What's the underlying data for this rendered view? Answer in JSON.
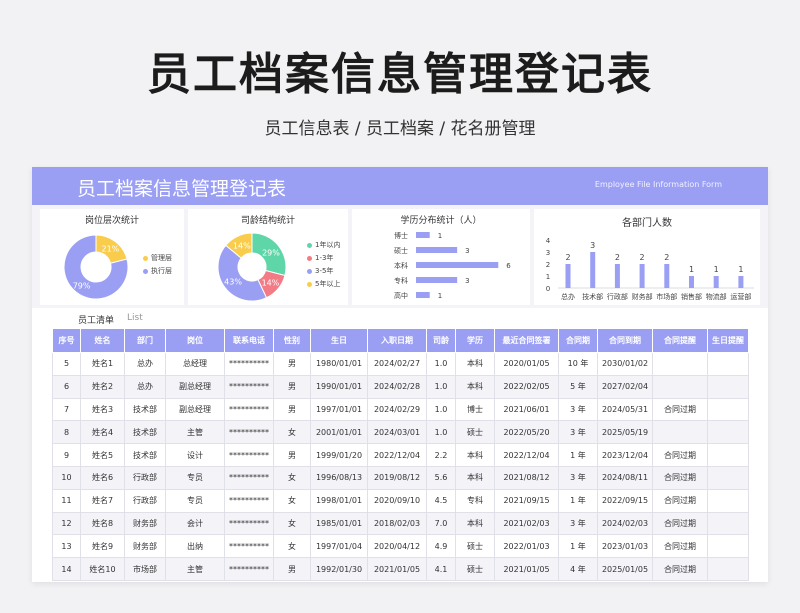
{
  "page_title": "员工档案信息管理登记表",
  "page_subtitle": "员工信息表 / 员工档案 / 花名册管理",
  "sheet": {
    "title": "员工档案信息管理登记表",
    "title_en": "Employee File Information Form"
  },
  "colors": {
    "accent": "#9a9ff4",
    "yellow": "#f9cd4b",
    "green": "#5fd6a8",
    "red": "#f37b85",
    "purple": "#9a9ff4"
  },
  "chart_data": [
    {
      "type": "pie",
      "title": "岗位层次统计",
      "categories": [
        "管理层",
        "执行层"
      ],
      "values": [
        21,
        79
      ],
      "data_labels": [
        "21%",
        "79%"
      ]
    },
    {
      "type": "pie",
      "title": "司龄结构统计",
      "categories": [
        "1年以内",
        "1-3年",
        "3-5年",
        "5年以上"
      ],
      "values": [
        29,
        14,
        43,
        14
      ],
      "data_labels": [
        "29%",
        "14%",
        "43%",
        "14%"
      ]
    },
    {
      "type": "bar",
      "orientation": "horizontal",
      "title": "学历分布统计（人）",
      "categories": [
        "博士",
        "硕士",
        "本科",
        "专科",
        "高中"
      ],
      "values": [
        1,
        3,
        6,
        3,
        1
      ],
      "xlim": [
        0,
        7
      ]
    },
    {
      "type": "bar",
      "title": "各部门人数",
      "categories": [
        "总办",
        "技术部",
        "行政部",
        "财务部",
        "市场部",
        "销售部",
        "物流部",
        "运营部"
      ],
      "values": [
        2,
        3,
        2,
        2,
        2,
        1,
        1,
        1
      ],
      "y_ticks": [
        "4",
        "3",
        "2",
        "1",
        "0"
      ],
      "ylim": [
        0,
        4
      ]
    }
  ],
  "list": {
    "title": "员工清单",
    "title_en": "List"
  },
  "table": {
    "headers": [
      "序号",
      "姓名",
      "部门",
      "岗位",
      "联系电话",
      "性别",
      "生日",
      "入职日期",
      "司龄",
      "学历",
      "最近合同签署",
      "合同期",
      "合同到期",
      "合同提醒",
      "生日提醒"
    ],
    "rows": [
      [
        "5",
        "姓名1",
        "总办",
        "总经理",
        "**********",
        "男",
        "1980/01/01",
        "2024/02/27",
        "1.0",
        "本科",
        "2020/01/05",
        "10 年",
        "2030/01/02",
        "",
        ""
      ],
      [
        "6",
        "姓名2",
        "总办",
        "副总经理",
        "**********",
        "男",
        "1990/01/01",
        "2024/02/28",
        "1.0",
        "本科",
        "2022/02/05",
        "5 年",
        "2027/02/04",
        "",
        ""
      ],
      [
        "7",
        "姓名3",
        "技术部",
        "副总经理",
        "**********",
        "男",
        "1997/01/01",
        "2024/02/29",
        "1.0",
        "博士",
        "2021/06/01",
        "3 年",
        "2024/05/31",
        "合同过期",
        ""
      ],
      [
        "8",
        "姓名4",
        "技术部",
        "主管",
        "**********",
        "女",
        "2001/01/01",
        "2024/03/01",
        "1.0",
        "硕士",
        "2022/05/20",
        "3 年",
        "2025/05/19",
        "",
        ""
      ],
      [
        "9",
        "姓名5",
        "技术部",
        "设计",
        "**********",
        "男",
        "1999/01/20",
        "2022/12/04",
        "2.2",
        "本科",
        "2022/12/04",
        "1 年",
        "2023/12/04",
        "合同过期",
        ""
      ],
      [
        "10",
        "姓名6",
        "行政部",
        "专员",
        "**********",
        "女",
        "1996/08/13",
        "2019/08/12",
        "5.6",
        "本科",
        "2021/08/12",
        "3 年",
        "2024/08/11",
        "合同过期",
        ""
      ],
      [
        "11",
        "姓名7",
        "行政部",
        "专员",
        "**********",
        "女",
        "1998/01/01",
        "2020/09/10",
        "4.5",
        "专科",
        "2021/09/15",
        "1 年",
        "2022/09/15",
        "合同过期",
        ""
      ],
      [
        "12",
        "姓名8",
        "财务部",
        "会计",
        "**********",
        "女",
        "1985/01/01",
        "2018/02/03",
        "7.0",
        "本科",
        "2021/02/03",
        "3 年",
        "2024/02/03",
        "合同过期",
        ""
      ],
      [
        "13",
        "姓名9",
        "财务部",
        "出纳",
        "**********",
        "女",
        "1997/01/04",
        "2020/04/12",
        "4.9",
        "硕士",
        "2022/01/03",
        "1 年",
        "2023/01/03",
        "合同过期",
        ""
      ],
      [
        "14",
        "姓名10",
        "市场部",
        "主管",
        "**********",
        "男",
        "1992/01/30",
        "2021/01/05",
        "4.1",
        "硕士",
        "2021/01/05",
        "4 年",
        "2025/01/05",
        "合同过期",
        ""
      ]
    ]
  }
}
